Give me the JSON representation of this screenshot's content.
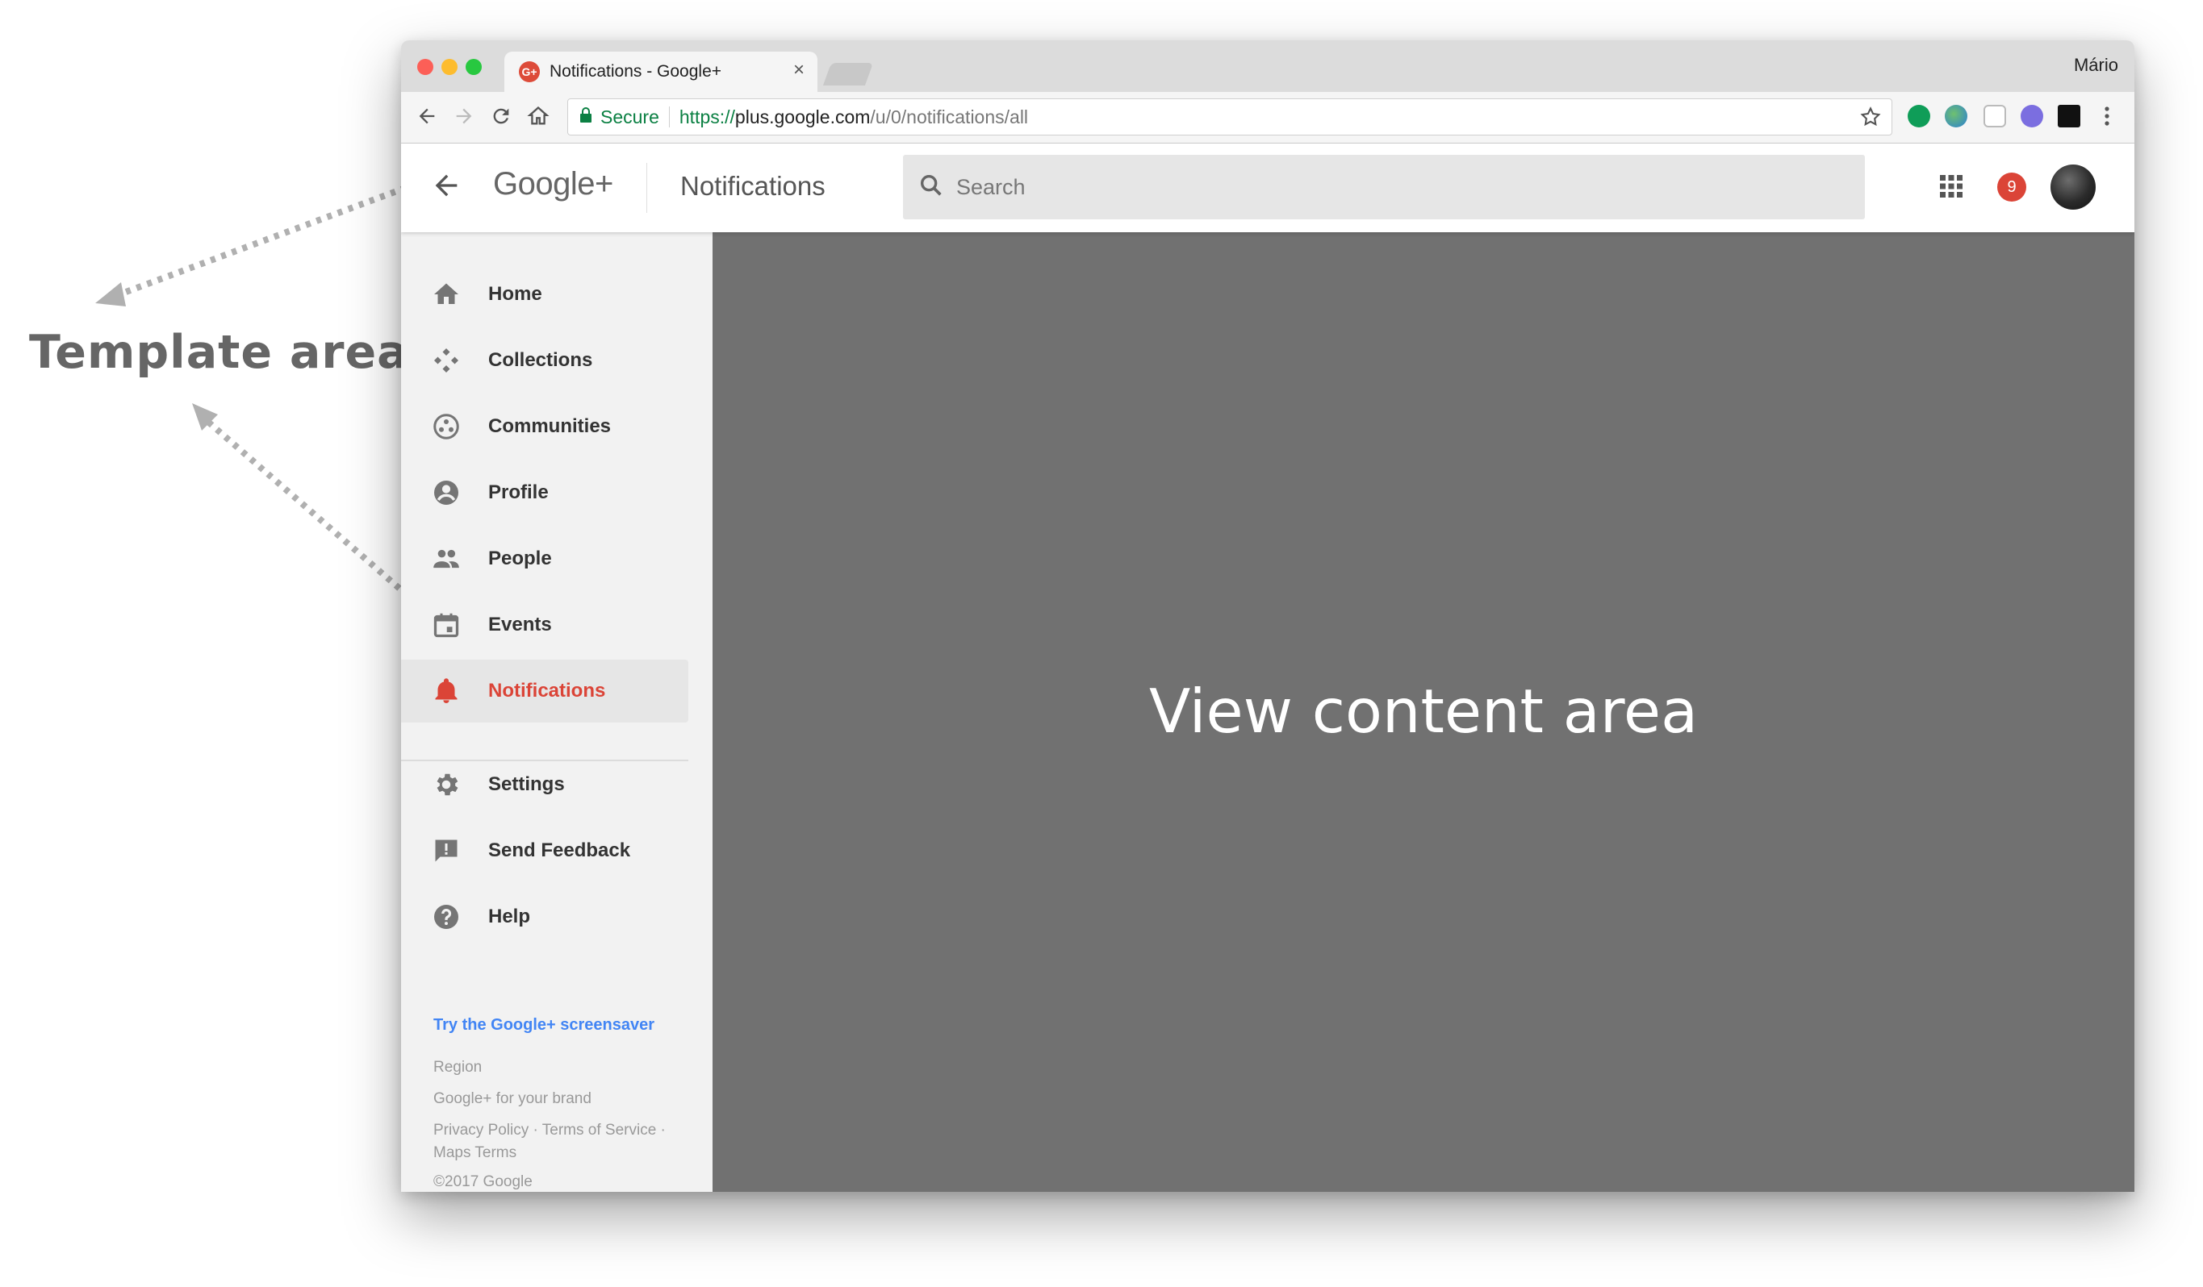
{
  "annotation": {
    "template_label": "Template area"
  },
  "browser": {
    "tab_title": "Notifications - Google+",
    "tab_favicon": "G+",
    "user_name": "Mário",
    "secure_label": "Secure",
    "url_scheme": "https://",
    "url_host": "plus.google.com",
    "url_path": "/u/0/notifications/all"
  },
  "header": {
    "logo": "Google+",
    "page_title": "Notifications",
    "search_placeholder": "Search",
    "notification_count": "9"
  },
  "sidebar": {
    "items": [
      {
        "label": "Home",
        "icon": "home-icon"
      },
      {
        "label": "Collections",
        "icon": "collections-icon"
      },
      {
        "label": "Communities",
        "icon": "communities-icon"
      },
      {
        "label": "Profile",
        "icon": "profile-icon"
      },
      {
        "label": "People",
        "icon": "people-icon"
      },
      {
        "label": "Events",
        "icon": "events-icon"
      },
      {
        "label": "Notifications",
        "icon": "bell-icon",
        "active": true
      }
    ],
    "secondary_items": [
      {
        "label": "Settings",
        "icon": "gear-icon"
      },
      {
        "label": "Send Feedback",
        "icon": "feedback-icon"
      },
      {
        "label": "Help",
        "icon": "help-icon"
      }
    ],
    "footer": {
      "screensaver_link": "Try the Google+ screensaver",
      "region": "Region",
      "brand": "Google+ for your brand",
      "legal": "Privacy Policy · Terms of Service · Maps Terms",
      "copyright": "©2017 Google"
    }
  },
  "content": {
    "label": "View content area"
  },
  "colors": {
    "accent_red": "#db4437",
    "link_blue": "#4285f4",
    "secure_green": "#0b8043",
    "content_gray": "#717171"
  }
}
